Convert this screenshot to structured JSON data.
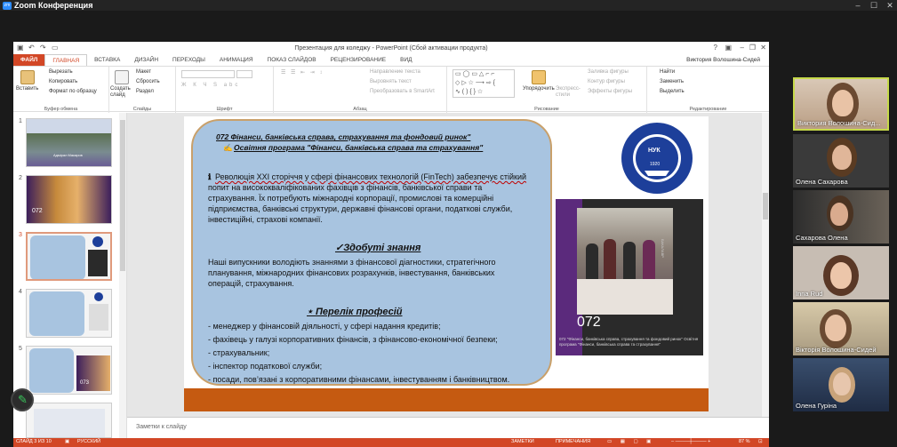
{
  "zoom": {
    "title": "Zoom Конференция",
    "logo": "zm"
  },
  "ppt": {
    "doc_title": "Презентация для коледжу - PowerPoint (Сбой активации продукта)",
    "user": "Виктория Волошина-Сидей",
    "tabs": [
      "ФАЙЛ",
      "ГЛАВНАЯ",
      "ВСТАВКА",
      "ДИЗАЙН",
      "ПЕРЕХОДЫ",
      "АНИМАЦИЯ",
      "ПОКАЗ СЛАЙДОВ",
      "РЕЦЕНЗИРОВАНИЕ",
      "ВИД"
    ],
    "ribbon": {
      "clipboard": {
        "paste": "Вставить",
        "cut": "Вырезать",
        "copy": "Копировать",
        "format": "Формат по образцу",
        "label": "Буфер обмена"
      },
      "slides": {
        "new": "Создать слайд",
        "layout": "Макет",
        "reset": "Сбросить",
        "section": "Раздел",
        "label": "Слайды"
      },
      "font": {
        "label": "Шрифт",
        "buttons": "Ж К Ч S abc"
      },
      "paragraph": {
        "direction": "Направление текста",
        "align": "Выровнять текст",
        "smartart": "Преобразовать в SmartArt",
        "label": "Абзац"
      },
      "drawing": {
        "arrange": "Упорядочить",
        "styles": "Экспресс-стили",
        "fill": "Заливка фигуры",
        "outline": "Контур фигуры",
        "effects": "Эффекты фигуры",
        "label": "Рисование"
      },
      "editing": {
        "find": "Найти",
        "replace": "Заменить",
        "select": "Выделить",
        "label": "Редактирование"
      }
    },
    "thumbnails": [
      {
        "num": "1",
        "text": "Адмірал Макаров"
      },
      {
        "num": "2",
        "text": "072"
      },
      {
        "num": "3",
        "text": ""
      },
      {
        "num": "4",
        "text": ""
      },
      {
        "num": "5",
        "text": "073"
      },
      {
        "num": "6",
        "text": ""
      }
    ],
    "slide": {
      "title1": "072 Фінанси, банківська справа, страхування та фондовий ринок\"",
      "title2": "Освітня програма \"Фінанси, банківська справа та страхування\"",
      "intro_lines": [
        "Революція ХХІ сторіччя у сфері фінансових технологій (FinTech) забезпечує стійкий",
        "попит на висококваліфікованих фахівців з фінансів, банківської справи та",
        "страхування. Їх потребують міжнародні корпорації, промислові та комерційні",
        "підприємства, банківські структури, державні фінансові органи, податкові служби,",
        "інвестиційні, страхові компанії."
      ],
      "knowledge_heading": "✓Здобуті знання",
      "knowledge_lines": [
        "Наші випускники володіють знаннями з фінансової діагностики, стратегічного",
        "планування, міжнародних фінансових розрахунків, інвестування, банківських",
        "операцій, страхування."
      ],
      "professions_heading": "⋆ Перелік професій",
      "professions": [
        "- менеджер у фінансовій діяльності, у сфері надання кредитів;",
        "- фахівець у галузі корпоративних фінансів, з фінансово-економічної безпеки;",
        "- страхувальник;",
        "- інспектор податкової служби;",
        "- посади, пов’язані з корпоративними фінансами, інвестуванням і банківництвом."
      ],
      "logo_text": "НУК",
      "logo_year": "1920",
      "logo_ring": "Admiral Makarov National University of Shipbuilding",
      "photo_code": "072",
      "photo_caption": "072 \"Фінанси, банківська справа, страхування та фондовий ринок\" Освітня програма \"Фінанси, банківська справа та страхування\"",
      "photo_side": "БАКАЛАВР"
    },
    "notes_placeholder": "Заметки к слайду",
    "status": {
      "slide": "СЛАЙД 3 ИЗ 10",
      "lang": "РУССКИЙ",
      "notes": "ЗАМЕТКИ",
      "comments": "ПРИМЕЧАНИЯ",
      "zoom": "87 %"
    }
  },
  "participants": [
    {
      "name": "Виктория Волошина-Сид...",
      "active": true
    },
    {
      "name": "Олена Сахарова",
      "active": false
    },
    {
      "name": "Сахарова Олена",
      "active": false
    },
    {
      "name": "Inna Rud",
      "active": false
    },
    {
      "name": "Вікторія Волошина-Сидей",
      "active": false
    },
    {
      "name": "Олена Гуріна",
      "active": false
    }
  ],
  "colors": {
    "ppt_accent": "#d24726",
    "bubble": "#a8c4e0",
    "active_speaker": "#c6d94a"
  }
}
